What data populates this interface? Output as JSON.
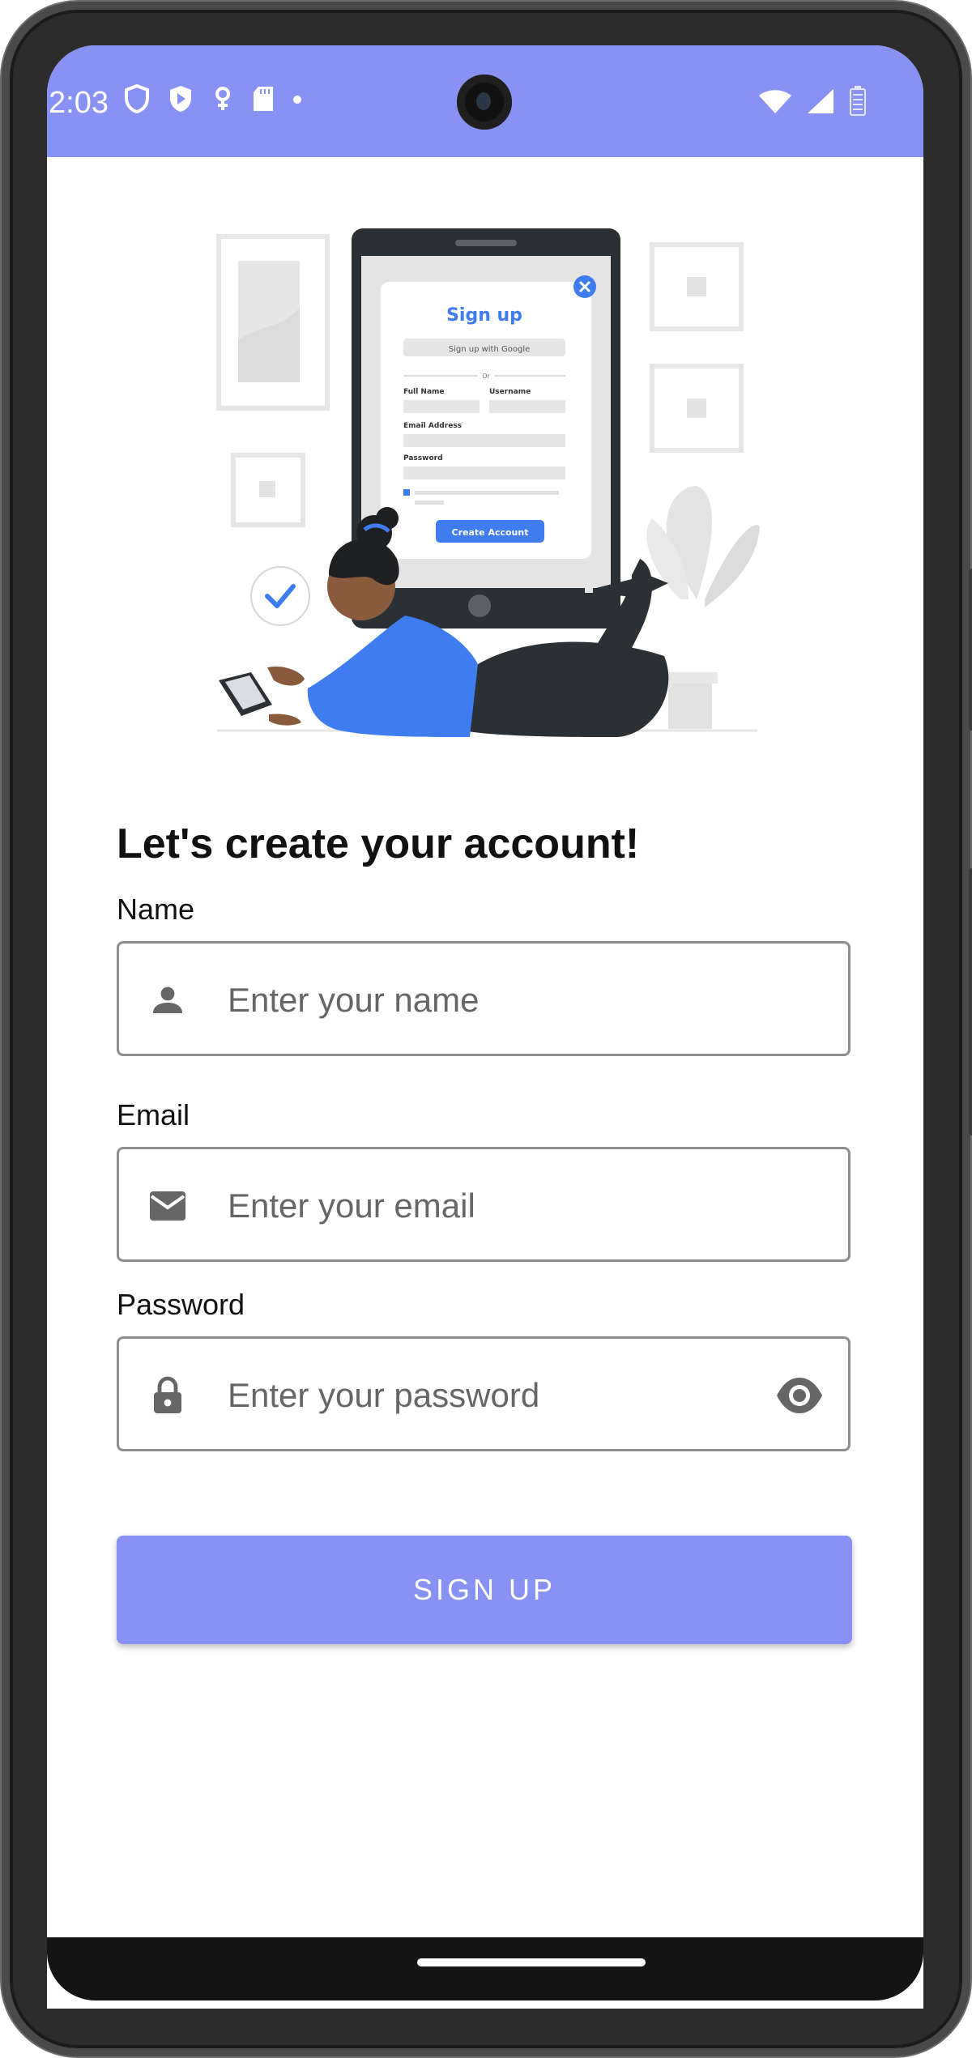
{
  "status_bar": {
    "time": "2:03",
    "icons": [
      "shield-icon",
      "play-shield-icon",
      "vpn-key-icon",
      "sd-card-icon",
      "dot-icon",
      "wifi-icon",
      "cell-signal-icon",
      "battery-icon"
    ]
  },
  "illustration": {
    "sign_up_title": "Sign up",
    "google_label": "Sign up with Google",
    "or_label": "Or",
    "full_name_label": "Full Name",
    "username_label": "Username",
    "email_address_label": "Email Address",
    "password_label": "Password",
    "create_account_label": "Create Account"
  },
  "form": {
    "title": "Let's create your account!",
    "name_label": "Name",
    "name_placeholder": "Enter your name",
    "email_label": "Email",
    "email_placeholder": "Enter your email",
    "password_label": "Password",
    "password_placeholder": "Enter your password",
    "signup_button": "SIGN UP"
  },
  "colors": {
    "accent": "#8891f4",
    "illustration_blue": "#3f7cf0",
    "icon_gray": "#666666"
  }
}
